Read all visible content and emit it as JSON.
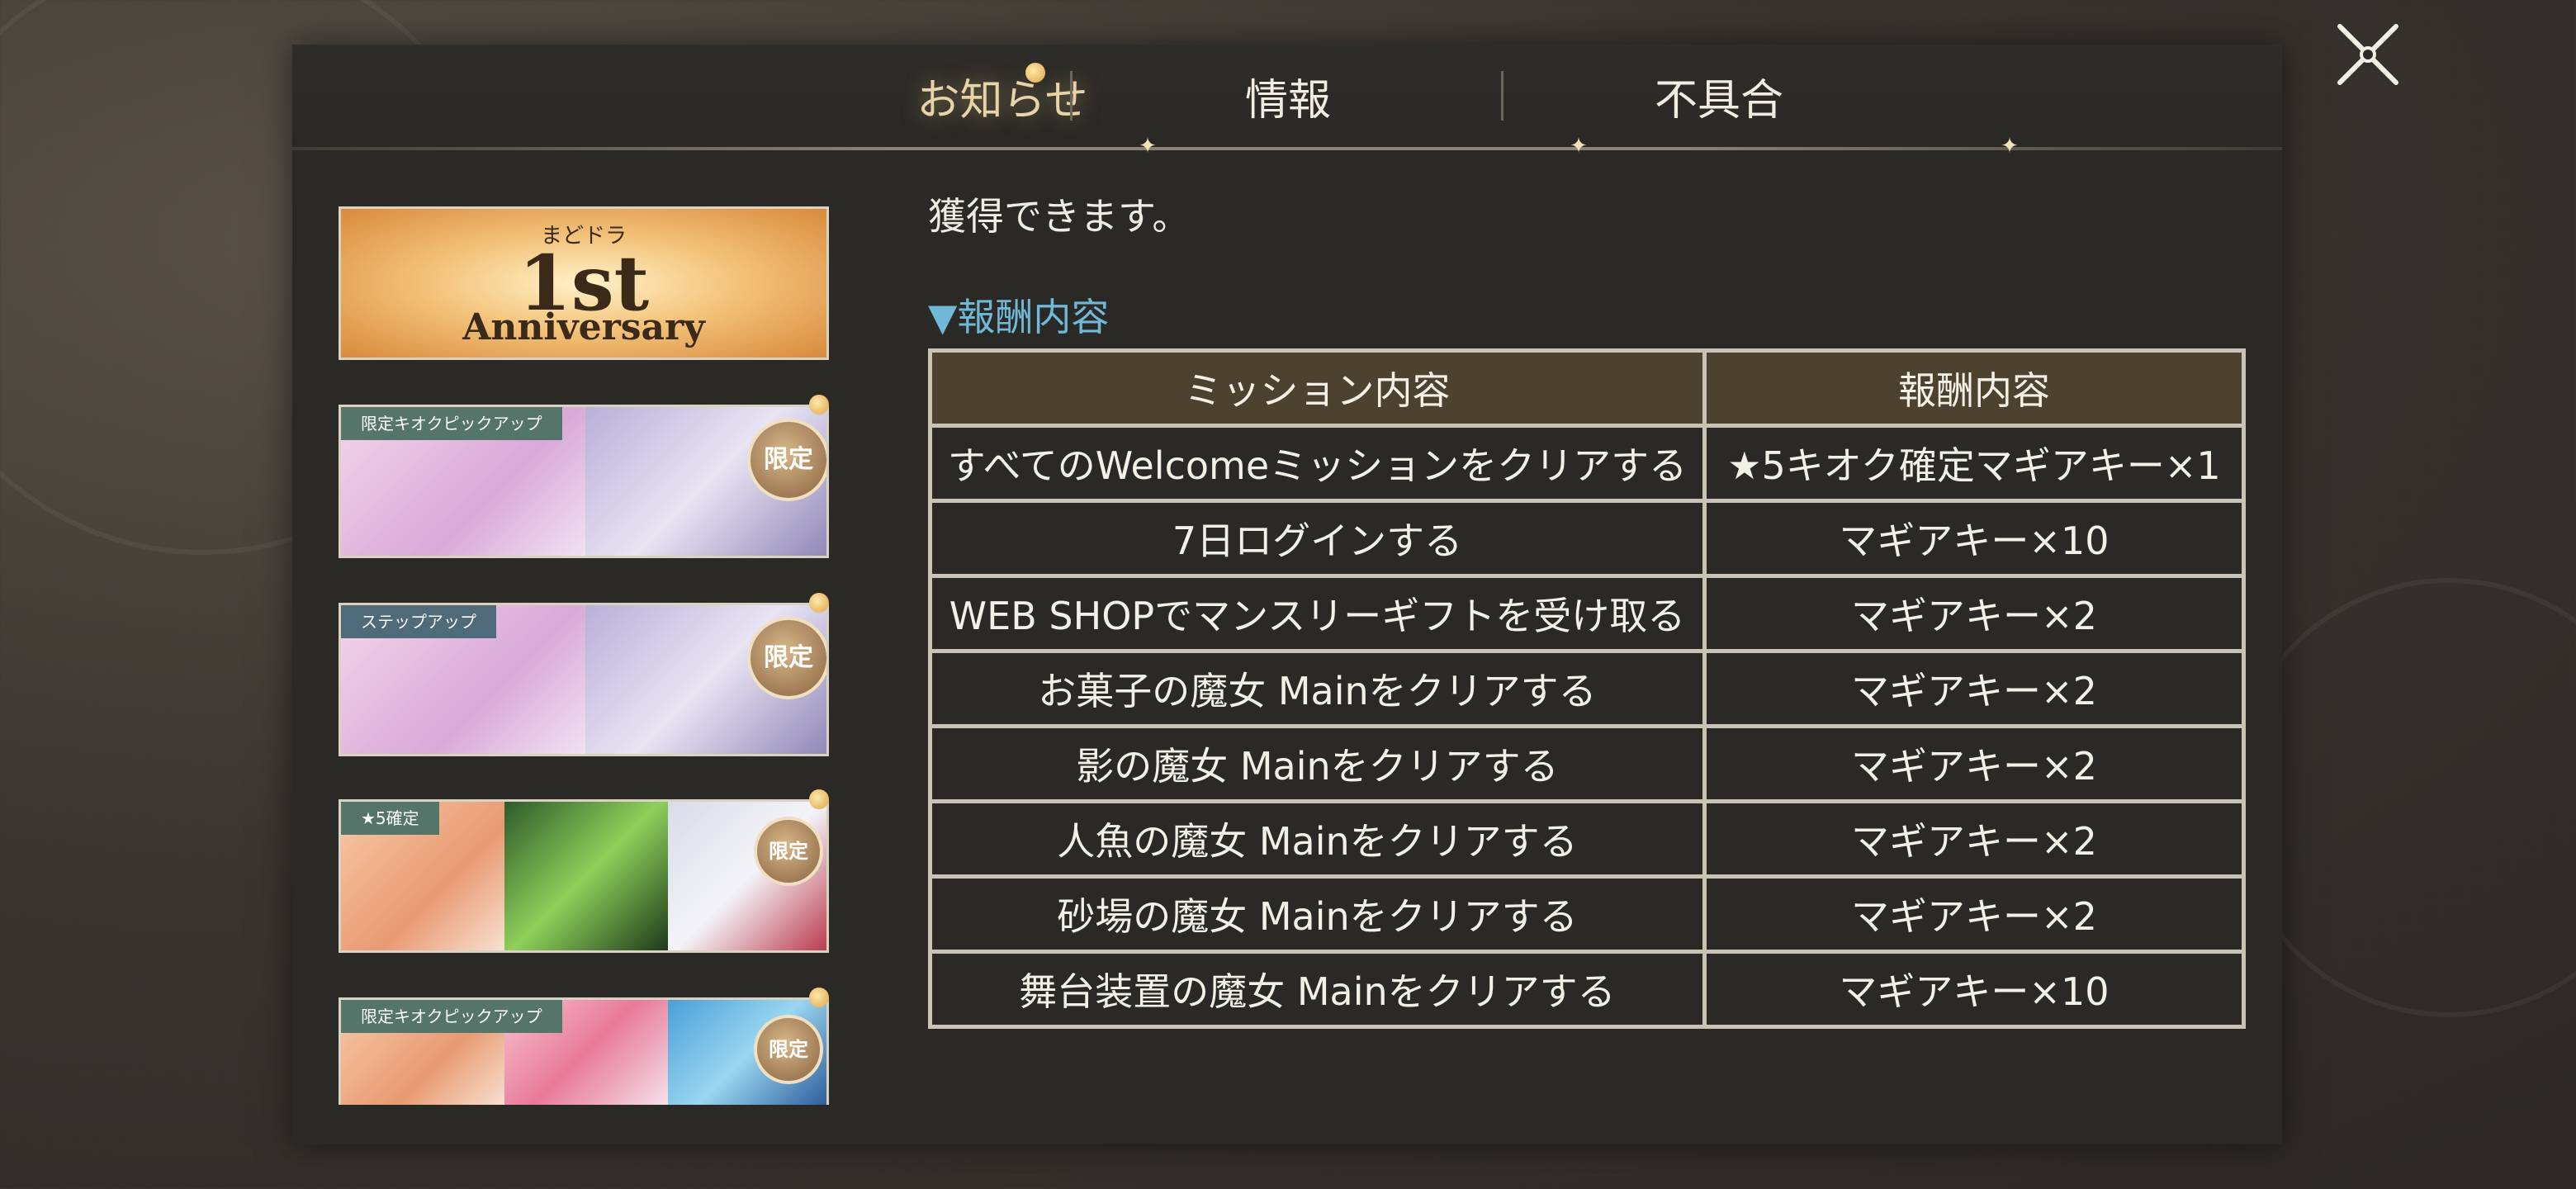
{
  "tabs": [
    {
      "label": "お知らせ",
      "active": true
    },
    {
      "label": "情報",
      "active": false
    },
    {
      "label": "不具合",
      "active": false
    }
  ],
  "banners": [
    {
      "kind": "anniversary",
      "text_small": "まどドラ",
      "text_big": "1st",
      "text_sub": "Anniversary"
    },
    {
      "kind": "pickup",
      "tag": "限定キオクピックアップ",
      "badge": "限定"
    },
    {
      "kind": "stepup",
      "tag": "ステップアップ",
      "badge": "限定"
    },
    {
      "kind": "star5",
      "tag": "★5確定",
      "badge": "限定"
    },
    {
      "kind": "pickup2",
      "tag": "限定キオクピックアップ",
      "badge": "限定"
    }
  ],
  "content": {
    "intro_text": "獲得できます。",
    "section_heading": "▼報酬内容"
  },
  "table": {
    "headers": [
      "ミッション内容",
      "報酬内容"
    ],
    "rows": [
      [
        "すべてのWelcomeミッションをクリアする",
        "★5キオク確定マギアキー×1"
      ],
      [
        "7日ログインする",
        "マギアキー×10"
      ],
      [
        "WEB SHOPでマンスリーギフトを受け取る",
        "マギアキー×2"
      ],
      [
        "お菓子の魔女 Mainをクリアする",
        "マギアキー×2"
      ],
      [
        "影の魔女 Mainをクリアする",
        "マギアキー×2"
      ],
      [
        "人魚の魔女 Mainをクリアする",
        "マギアキー×2"
      ],
      [
        "砂場の魔女 Mainをクリアする",
        "マギアキー×2"
      ],
      [
        "舞台装置の魔女 Mainをクリアする",
        "マギアキー×10"
      ]
    ]
  },
  "colors": {
    "accent_heading": "#6fb8d8",
    "table_header_bg": "#4d4130",
    "panel_bg": "#2b2926"
  }
}
